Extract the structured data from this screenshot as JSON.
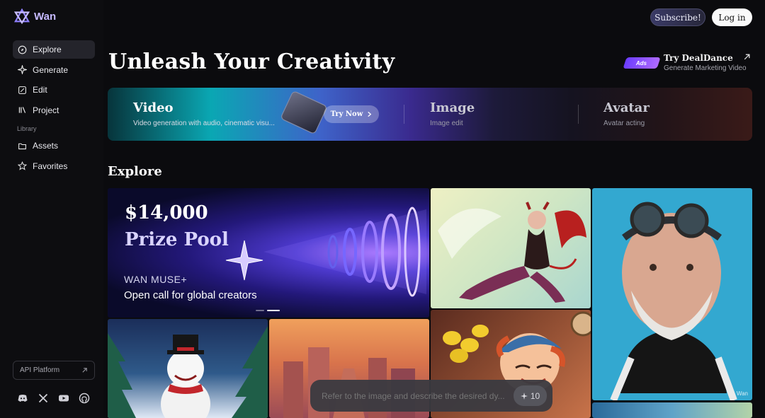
{
  "app": {
    "name": "Wan",
    "brand_color": "#7c6cff"
  },
  "header": {
    "subscribe_label": "Subscribe!",
    "login_label": "Log in"
  },
  "sidebar": {
    "items": [
      {
        "label": "Explore",
        "icon": "compass-icon",
        "active": true
      },
      {
        "label": "Generate",
        "icon": "sparkle-icon",
        "active": false
      },
      {
        "label": "Edit",
        "icon": "edit-icon",
        "active": false
      },
      {
        "label": "Project",
        "icon": "project-icon",
        "active": false
      }
    ],
    "library_label": "Library",
    "library_items": [
      {
        "label": "Assets",
        "icon": "folder-icon"
      },
      {
        "label": "Favorites",
        "icon": "star-icon"
      }
    ],
    "api_label": "API Platform",
    "socials": [
      "discord-icon",
      "x-icon",
      "youtube-icon",
      "github-icon"
    ]
  },
  "main": {
    "title": "Unleash Your Creativity",
    "ad": {
      "badge": "Ads",
      "title": "Try DealDance",
      "subtitle": "Generate Marketing Video"
    },
    "banner": {
      "segments": [
        {
          "title": "Video",
          "subtitle": "Video generation with audio, cinematic visu..."
        },
        {
          "title": "Image",
          "subtitle": "Image edit"
        },
        {
          "title": "Avatar",
          "subtitle": "Avatar acting"
        }
      ],
      "try_now": "Try Now"
    },
    "explore_heading": "Explore",
    "hero": {
      "amount": "$14,000",
      "pool": "Prize Pool",
      "brand": "WAN MUSE+",
      "call": "Open call for global creators"
    },
    "watermark": "Wan"
  },
  "prompt": {
    "placeholder": "Refer to the image and describe the desired dy...",
    "credits": "10"
  }
}
